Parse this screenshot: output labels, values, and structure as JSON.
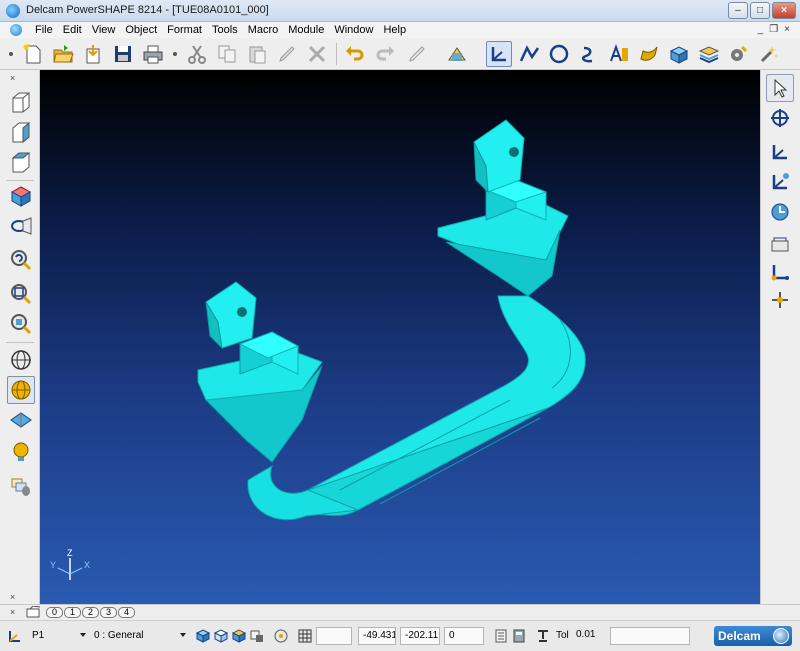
{
  "window": {
    "title": "Delcam PowerSHAPE 8214 - [TUE08A0101_000]"
  },
  "menu": {
    "items": [
      "File",
      "Edit",
      "View",
      "Object",
      "Format",
      "Tools",
      "Macro",
      "Module",
      "Window",
      "Help"
    ]
  },
  "main_toolbar": {
    "icons": [
      "new-file-icon",
      "open-folder-icon",
      "import-icon",
      "save-icon",
      "print-icon",
      "cut-icon",
      "copy-icon",
      "paste-icon",
      "edit-icon",
      "delete-icon",
      "undo-icon",
      "redo-icon",
      "pencil-icon",
      "dimension-icon",
      "workplane-icon",
      "line-icon",
      "arc-icon",
      "curve-icon",
      "text-icon",
      "surface-icon",
      "solid-icon",
      "mesh-icon",
      "feature-icon",
      "tools-icon"
    ]
  },
  "left_toolbar": {
    "icons": [
      "view-front-icon",
      "view-side-icon",
      "view-top-icon",
      "view-iso-icon",
      "view-rotate-icon",
      "zoom-previous-icon",
      "zoom-window-icon",
      "zoom-fit-icon",
      "wireframe-icon",
      "shaded-icon",
      "plane-icon",
      "light-icon",
      "material-icon"
    ]
  },
  "right_toolbar": {
    "icons": [
      "select-arrow-icon",
      "move-icon",
      "workplane-icon",
      "workplane-edit-icon",
      "dial-icon",
      "measure-icon",
      "axis-icon",
      "snap-icon"
    ]
  },
  "viewport": {
    "triad": {
      "z_label": "Z",
      "y_label": "Y",
      "x_label": "X"
    },
    "model_color": "#19f0f0",
    "background_top": "#000000",
    "background_bottom": "#2a5ab2"
  },
  "view_tabs": [
    "0",
    "1",
    "2",
    "3",
    "4"
  ],
  "status": {
    "workplane": "P1",
    "level": "0 : General",
    "x": "-49.431",
    "y": "-202.11",
    "z": "0",
    "tol_label": "Tol",
    "tol_value": "0.01",
    "brand": "Delcam"
  }
}
